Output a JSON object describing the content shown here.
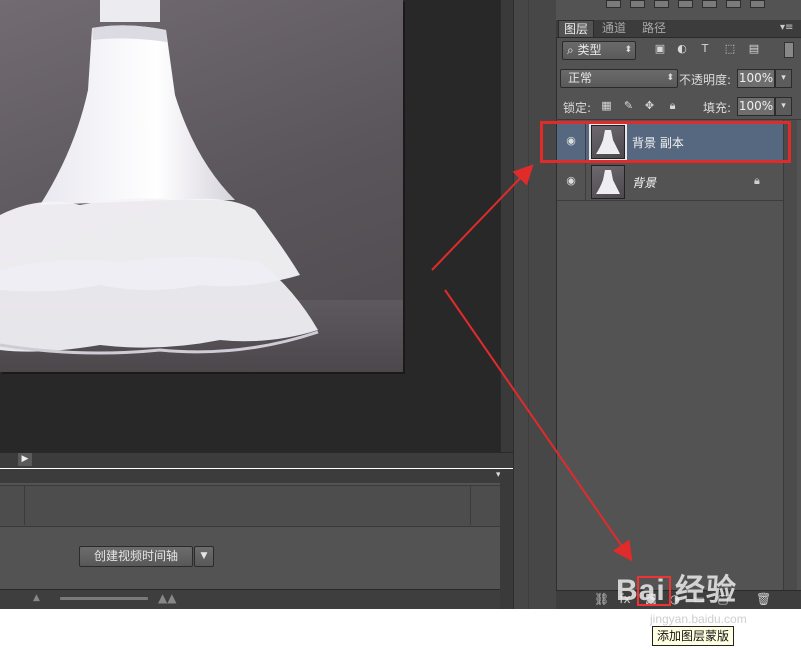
{
  "layers_panel": {
    "tabs": [
      {
        "label": "图层"
      },
      {
        "label": "通道"
      },
      {
        "label": "路径"
      }
    ],
    "filter_select": "类型",
    "blend_mode": "正常",
    "opacity_label": "不透明度:",
    "opacity_value": "100%",
    "lock_label": "锁定:",
    "fill_label": "填充:",
    "fill_value": "100%",
    "layers": [
      {
        "name": "背景 副本",
        "selected": true
      },
      {
        "name": "背景",
        "locked": true
      }
    ]
  },
  "timeline": {
    "create_button_label": "创建视频时间轴"
  },
  "tooltip": "添加图层蒙版",
  "watermark": {
    "brand": "Bai 经验",
    "url": "jingyan.baidu.com"
  },
  "annotation_color": "#e02b2b",
  "icons": {
    "eye": "eye-icon",
    "lock": "lock-icon",
    "link": "link-icon",
    "mask": "add-mask-icon",
    "trash": "trash-icon"
  }
}
